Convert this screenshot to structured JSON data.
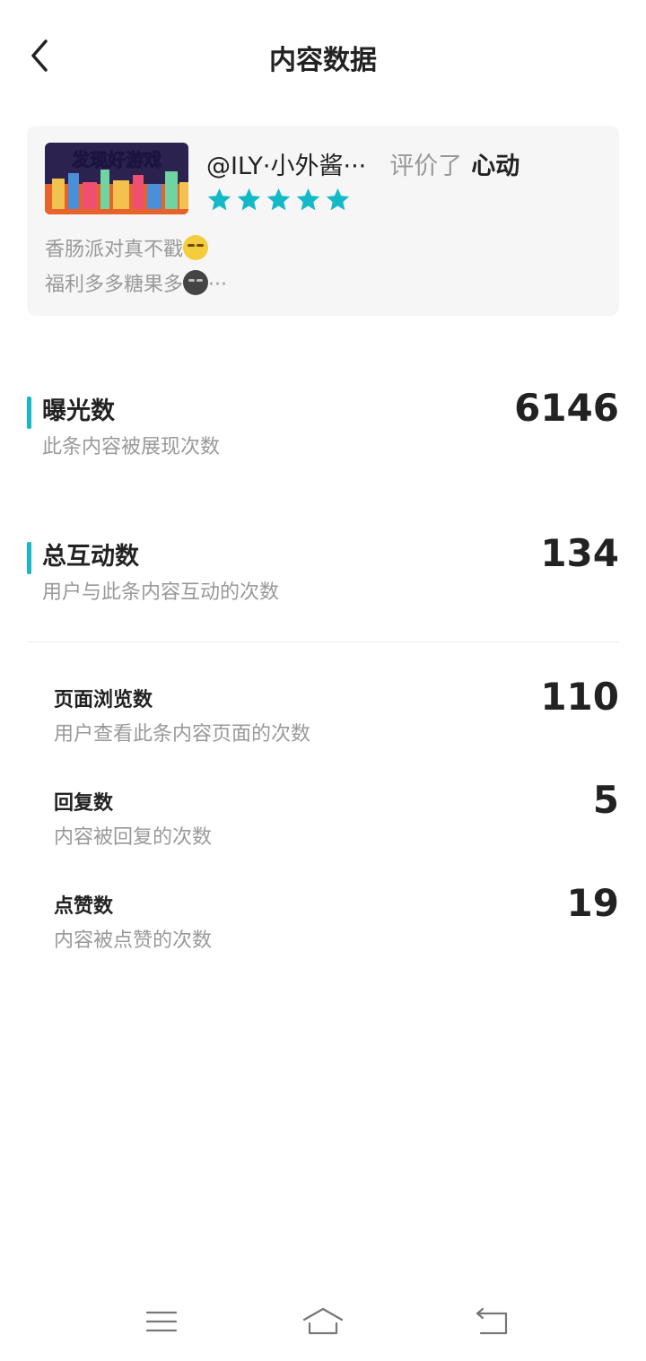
{
  "header": {
    "title": "内容数据",
    "back_icon": "chevron-left-icon"
  },
  "post": {
    "thumbnail_caption": "发现好游戏",
    "username": "@ILY·小外酱···",
    "action": "评价了",
    "game": "心动",
    "rating": 5,
    "text_line1": "香肠派对真不戳",
    "text_line2": "福利多多糖果多",
    "ellipsis": "···",
    "star_color": "#14b9c8"
  },
  "metrics": {
    "exposure": {
      "label": "曝光数",
      "desc": "此条内容被展现次数",
      "value": "6146"
    },
    "interaction": {
      "label": "总互动数",
      "desc": "用户与此条内容互动的次数",
      "value": "134"
    }
  },
  "sub_metrics": {
    "pageviews": {
      "label": "页面浏览数",
      "desc": "用户查看此条内容页面的次数",
      "value": "110"
    },
    "replies": {
      "label": "回复数",
      "desc": "内容被回复的次数",
      "value": "5"
    },
    "likes": {
      "label": "点赞数",
      "desc": "内容被点赞的次数",
      "value": "19"
    }
  },
  "navbar": {
    "menu_icon": "menu-icon",
    "home_icon": "home-icon",
    "back_icon": "return-icon"
  },
  "colors": {
    "accent": "#14b9c8",
    "muted_text": "#999999",
    "card_bg": "#f6f6f6"
  }
}
